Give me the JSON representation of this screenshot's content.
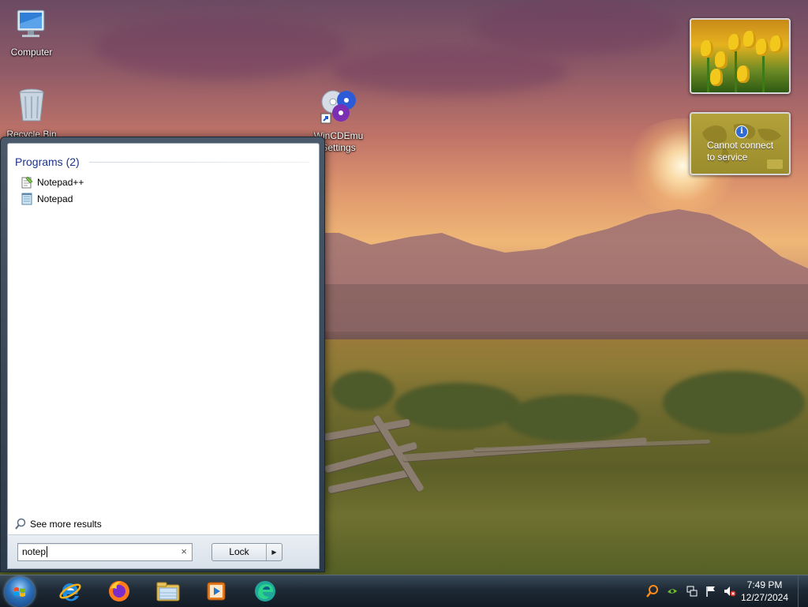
{
  "desktop": {
    "icons": [
      {
        "label": "Computer"
      },
      {
        "label": "Recycle Bin"
      },
      {
        "label": "WinCDEmu Settings"
      }
    ]
  },
  "gadgets": {
    "weather_message": "Cannot connect to service"
  },
  "start_menu": {
    "section_title": "Programs (2)",
    "results": [
      {
        "label": "Notepad++",
        "icon": "notepadpp-icon"
      },
      {
        "label": "Notepad",
        "icon": "notepad-icon"
      }
    ],
    "see_more": "See more results",
    "search_value": "notep",
    "power_button": "Lock"
  },
  "taskbar": {
    "pinned": [
      "internet-explorer-icon",
      "firefox-icon",
      "file-explorer-icon",
      "media-player-icon",
      "edge-icon"
    ],
    "time": "7:49 PM",
    "date": "12/27/2024"
  }
}
